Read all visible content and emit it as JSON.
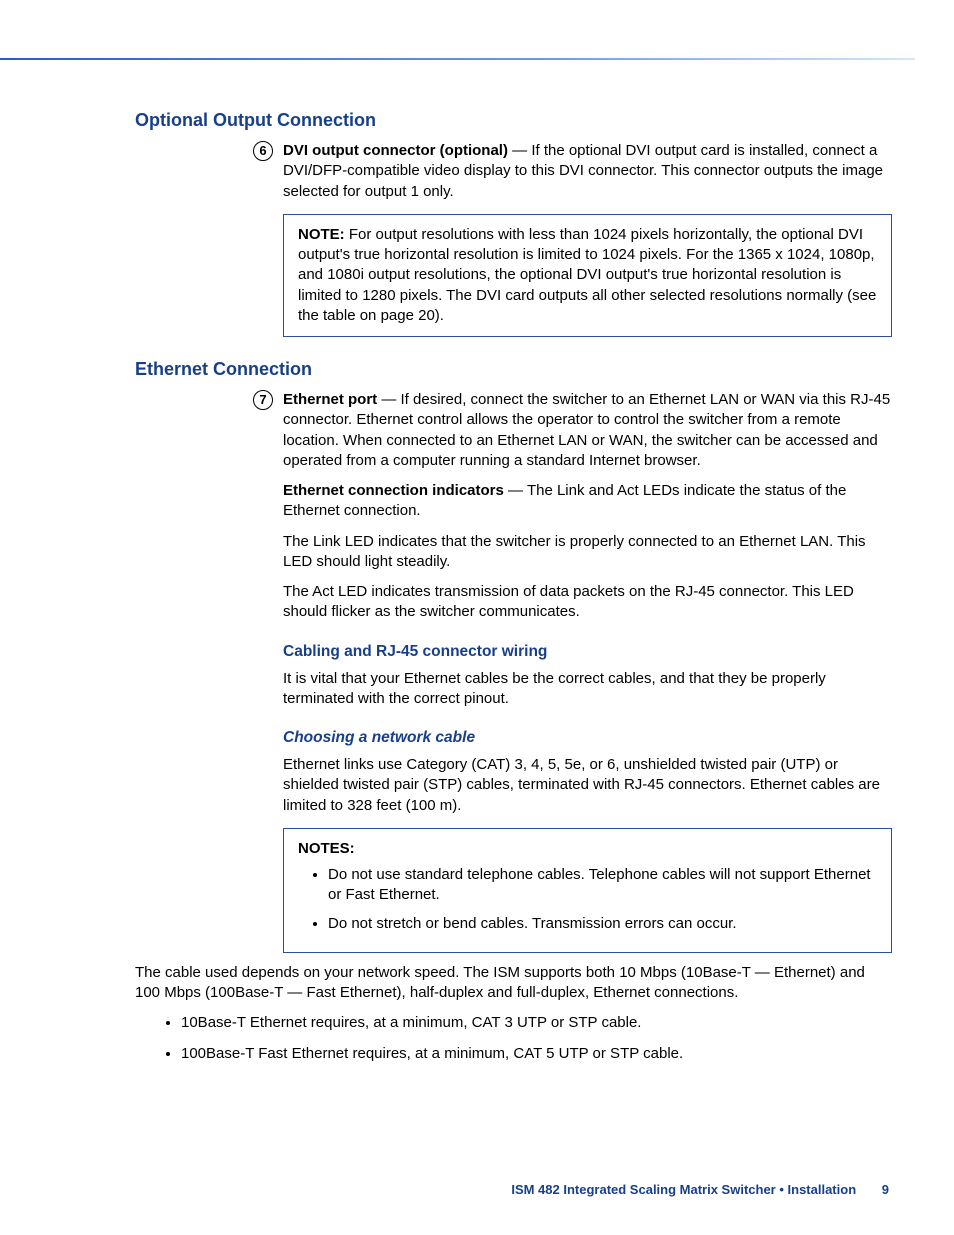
{
  "section1": {
    "heading": "Optional Output Connection",
    "callout_num": "6",
    "lead_bold": "DVI output connector (optional)",
    "lead_text": " — If the optional DVI output card is installed, connect a DVI/DFP-compatible video display to this DVI connector. This connector outputs the image selected for output 1 only.",
    "note_label": "NOTE:",
    "note_text": "  For output resolutions with less than 1024 pixels horizontally, the optional DVI output's true horizontal resolution is limited to 1024 pixels. For the 1365 x 1024, 1080p, and 1080i output resolutions, the optional DVI output's true horizontal resolution is limited to 1280 pixels. The DVI card outputs all other selected resolutions normally (see the table on page 20)."
  },
  "section2": {
    "heading": "Ethernet Connection",
    "callout_num": "7",
    "p1_bold": "Ethernet port",
    "p1_text": " — If desired, connect the switcher to an Ethernet LAN or WAN via this RJ-45 connector. Ethernet control allows the operator to control the switcher from a remote location. When connected to an Ethernet LAN or WAN, the switcher can be accessed and operated from a computer running a standard Internet browser.",
    "p2_bold": "Ethernet connection indicators",
    "p2_text": " — The Link and Act LEDs indicate the status of the Ethernet connection.",
    "p3": "The Link LED indicates that the switcher is properly connected to an Ethernet LAN. This LED should light steadily.",
    "p4": "The Act LED indicates transmission of data packets on the RJ-45 connector. This LED should flicker as the switcher communicates.",
    "sub1_heading": "Cabling and RJ-45 connector wiring",
    "sub1_p1": "It is vital that your Ethernet cables be the correct cables, and that they be properly terminated with the correct pinout.",
    "sub2_heading": "Choosing a network cable",
    "sub2_p1": "Ethernet links use Category (CAT) 3, 4, 5, 5e, or 6, unshielded twisted pair (UTP) or shielded twisted pair (STP) cables, terminated with RJ-45 connectors. Ethernet cables are limited to 328 feet (100 m).",
    "notes_label": "NOTES:",
    "notes_items": [
      "Do not use standard telephone cables. Telephone cables will not support Ethernet or Fast Ethernet.",
      "Do not stretch or bend cables. Transmission errors can occur."
    ],
    "after_notes": "The cable used depends on your network speed. The ISM supports both 10 Mbps (10Base-T — Ethernet) and 100 Mbps (100Base-T — Fast Ethernet), half-duplex and full-duplex, Ethernet connections.",
    "cable_items": [
      "10Base-T Ethernet requires, at a minimum, CAT 3 UTP or STP cable.",
      "100Base-T Fast Ethernet requires, at a minimum, CAT 5 UTP or STP cable."
    ]
  },
  "footer": {
    "title": "ISM 482 Integrated Scaling Matrix Switcher • Installation",
    "page": "9"
  }
}
